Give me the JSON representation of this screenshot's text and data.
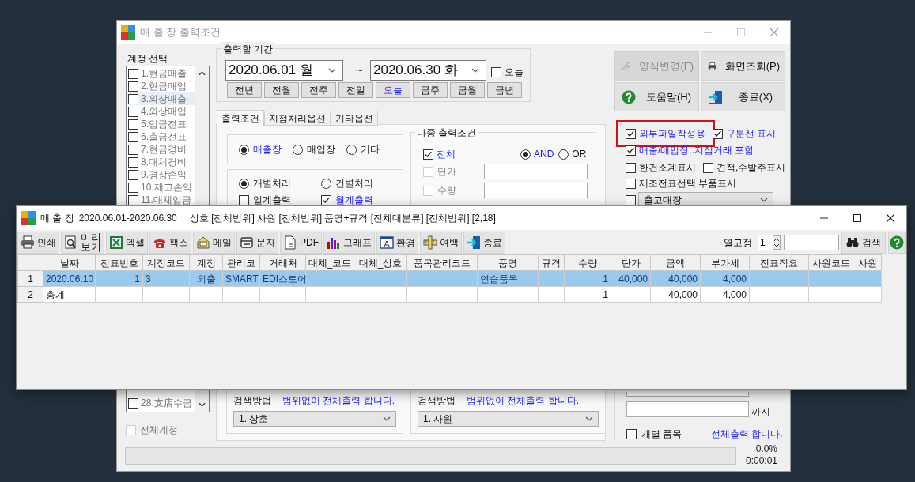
{
  "back_window": {
    "title": "매 출 장 출력조건",
    "accounts": {
      "label": "계정 선택",
      "items": [
        {
          "label": "1.현금매출",
          "checked": false,
          "selected": false
        },
        {
          "label": "2.현금매입",
          "checked": false,
          "selected": false
        },
        {
          "label": "3.외상매출",
          "checked": false,
          "selected": true
        },
        {
          "label": "4.외상매입",
          "checked": false,
          "selected": false
        },
        {
          "label": "5.입금전표",
          "checked": false,
          "selected": false
        },
        {
          "label": "6.출금전표",
          "checked": false,
          "selected": false
        },
        {
          "label": "7.현금경비",
          "checked": false,
          "selected": false
        },
        {
          "label": "8.대체경비",
          "checked": false,
          "selected": false
        },
        {
          "label": "9.경상손익",
          "checked": false,
          "selected": false
        },
        {
          "label": "10.재고손익",
          "checked": false,
          "selected": false
        },
        {
          "label": "11.대체입금",
          "checked": false,
          "selected": false
        }
      ],
      "last_items": [
        {
          "label": "28.支店수금",
          "checked": false,
          "selected": false
        }
      ],
      "all": {
        "label": "전체계정",
        "checked": false,
        "disabled": true
      }
    },
    "period": {
      "label": "출력할 기간",
      "start": "2020.06.01 월",
      "separator": "~",
      "end": "2020.06.30 화",
      "today": {
        "label": "오늘",
        "checked": false
      },
      "buttons": [
        {
          "label": "전년",
          "selected": false
        },
        {
          "label": "전월",
          "selected": false
        },
        {
          "label": "전주",
          "selected": false
        },
        {
          "label": "전일",
          "selected": false
        },
        {
          "label": "오늘",
          "selected": true
        },
        {
          "label": "금주",
          "selected": false
        },
        {
          "label": "금월",
          "selected": false
        },
        {
          "label": "금년",
          "selected": false
        }
      ]
    },
    "tabs": [
      {
        "label": "출력조건",
        "selected": true
      },
      {
        "label": "지점처리옵션",
        "selected": false
      },
      {
        "label": "기타옵션",
        "selected": false
      }
    ],
    "report_type": [
      {
        "label": "매출장",
        "selected": true,
        "emphasis": true
      },
      {
        "label": "매입장",
        "selected": false,
        "emphasis": false
      },
      {
        "label": "기타",
        "selected": false,
        "emphasis": false
      }
    ],
    "processing": [
      {
        "kind": "radio",
        "label": "개별처리",
        "checked": true,
        "emphasis": false
      },
      {
        "kind": "radio",
        "label": "건별처리",
        "checked": false,
        "emphasis": false
      },
      {
        "kind": "checkbox",
        "label": "일계출력",
        "checked": false,
        "emphasis": false
      },
      {
        "kind": "checkbox",
        "label": "월계출력",
        "checked": true,
        "emphasis": true
      }
    ],
    "multi": {
      "title": "다중 출력조건",
      "all": {
        "label": "전체",
        "checked": true
      },
      "logic": [
        {
          "label": "AND",
          "selected": true
        },
        {
          "label": "OR",
          "selected": false
        }
      ],
      "filters": [
        {
          "label": "단가",
          "checked": false,
          "disabled": true
        },
        {
          "label": "수량",
          "checked": false,
          "disabled": true
        }
      ]
    },
    "search_groups": [
      {
        "label": "검색방법",
        "note": "범위없이 전체출력 합니다.",
        "value": "1. 상호"
      },
      {
        "label": "검색방법",
        "note": "범위없이 전체출력 합니다.",
        "value": "1. 사원"
      }
    ],
    "actions": [
      {
        "label": "양식변경(F)",
        "disabled": true
      },
      {
        "label": "화면조회(P)",
        "disabled": false
      },
      {
        "label": "도움말(H)",
        "disabled": false
      },
      {
        "label": "종료(X)",
        "disabled": false
      }
    ],
    "options": [
      {
        "label": "외부파일작성용",
        "checked": true,
        "emphasis": true,
        "outlined": true
      },
      {
        "label": "구분선 표시",
        "checked": true,
        "emphasis": true,
        "outlined": false
      },
      {
        "label": "매출/매입장..지점거래 포함",
        "checked": true,
        "emphasis": true,
        "outlined": false
      },
      {
        "label": "한건소계표시",
        "checked": false,
        "emphasis": false,
        "outlined": false
      },
      {
        "label": "견적,수발주표시",
        "checked": false,
        "emphasis": false,
        "outlined": false
      },
      {
        "label": "제조전표선택 부품표시",
        "checked": false,
        "emphasis": false,
        "outlined": false
      }
    ],
    "ledger": {
      "checked": false,
      "value": "출고대장"
    },
    "range": {
      "to_label": "까지"
    },
    "item_filter": {
      "label": "개별 품목",
      "checked": false,
      "note": "전체출력 합니다."
    },
    "progress": {
      "level": 0,
      "percent": "0.0%",
      "elapsed": "0:00:01"
    }
  },
  "front_window": {
    "title": "매 출 장",
    "period": "2020.06.01-2020.06.30",
    "filters": "상호 [전체범위] 사원 [전체범위] 품명+규격 [전체대분류] [전체범위] [2,18]",
    "toolbar": [
      "인쇄",
      "미리 보기",
      "엑셀",
      "팩스",
      "메일",
      "문자",
      "PDF",
      "그래프",
      "환경",
      "여백",
      "종료"
    ],
    "freeze": {
      "label": "열고정",
      "value": "1"
    },
    "search_button": "검색",
    "table": {
      "columns": [
        "날짜",
        "전표번호",
        "계정코드",
        "계정",
        "관리코",
        "거래처",
        "대체_코드",
        "대체_상호",
        "품목관리코드",
        "품명",
        "규격",
        "수량",
        "단가",
        "금액",
        "부가세",
        "전표적요",
        "사원코드",
        "사원"
      ],
      "rows": [
        {
          "number": "1",
          "selected": true,
          "cells": [
            "2020.06.10",
            "1",
            "3",
            "외출",
            "SMART",
            "EDI스토어",
            null,
            null,
            null,
            "연습품목",
            null,
            "1",
            "40,000",
            "40,000",
            "4,000",
            null,
            null,
            null
          ]
        },
        {
          "number": "2",
          "selected": false,
          "cells": [
            "총계",
            null,
            null,
            null,
            null,
            null,
            null,
            null,
            null,
            null,
            null,
            "1",
            null,
            "40,000",
            "4,000",
            null,
            null,
            null
          ]
        }
      ]
    }
  }
}
